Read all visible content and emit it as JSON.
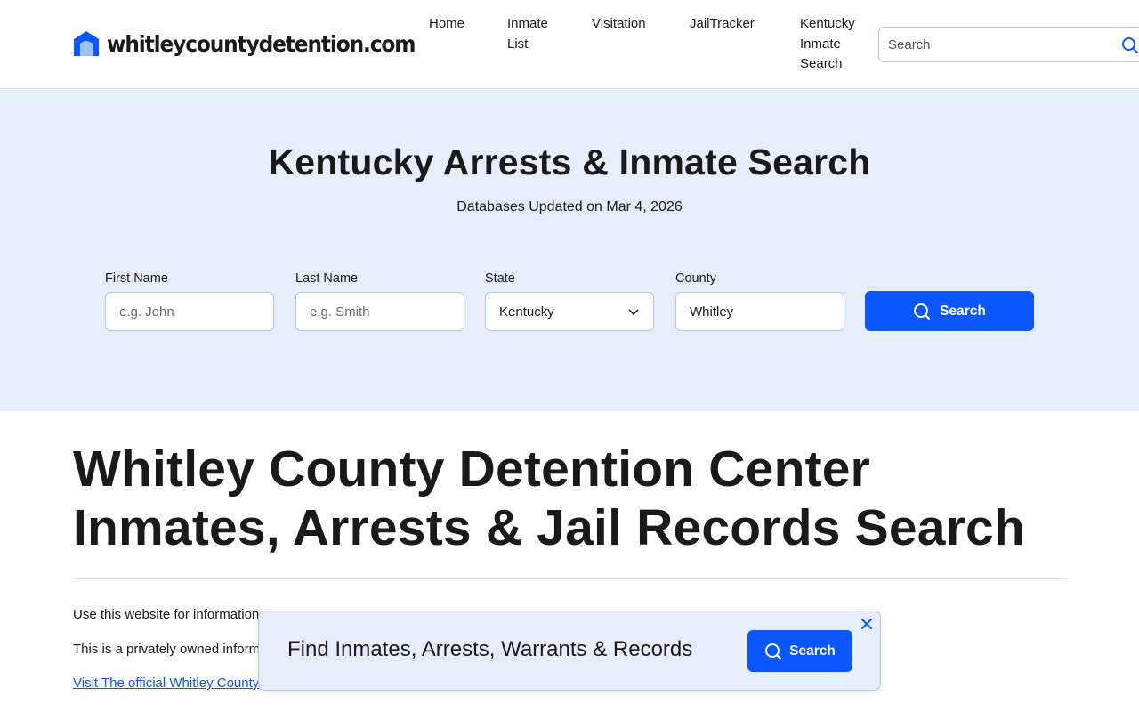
{
  "header": {
    "logo_text": "whitleycountydetention.com",
    "nav": {
      "home": "Home",
      "inmate_list": "Inmate List",
      "visitation": "Visitation",
      "jailtracker": "JailTracker",
      "kentucky_search": "Kentucky Inmate Search"
    },
    "search": {
      "placeholder": "Search",
      "value": ""
    }
  },
  "hero": {
    "title": "Kentucky Arrests & Inmate Search",
    "subtitle": "Databases Updated on Mar 4, 2026",
    "form": {
      "first_name": {
        "label": "First Name",
        "placeholder": "e.g. John",
        "value": ""
      },
      "last_name": {
        "label": "Last Name",
        "placeholder": "e.g. Smith",
        "value": ""
      },
      "state": {
        "label": "State",
        "value": "Kentucky"
      },
      "county": {
        "label": "County",
        "value": "Whitley"
      },
      "button": "Search"
    }
  },
  "main": {
    "title": "Whitley County Detention Center Inmates, Arrests & Jail Records Search",
    "paragraphs": [
      "Use this website for information",
      "This is a privately owned inform",
      "Visit The official Whitley County"
    ]
  },
  "popup": {
    "text": "Find Inmates, Arrests, Warrants & Records",
    "button": "Search"
  },
  "colors": {
    "accent": "#0a57ff",
    "hero_bg": "#e6edfb",
    "text": "#1a1a1a"
  },
  "icons": [
    "home-logo-icon",
    "search-icon",
    "chevron-down-icon",
    "close-icon"
  ]
}
